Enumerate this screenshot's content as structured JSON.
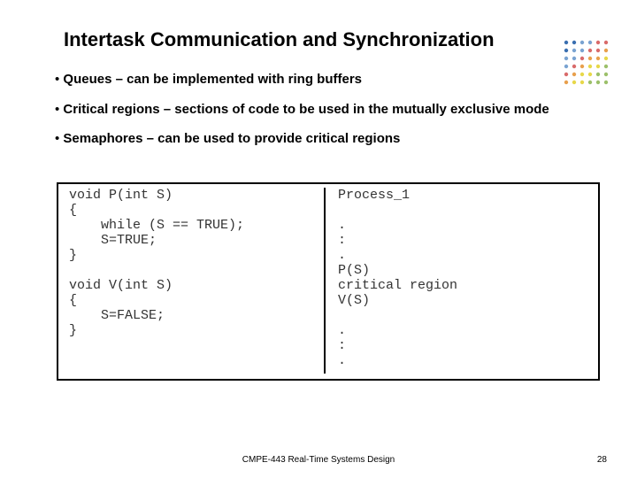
{
  "title": "Intertask Communication and Synchronization",
  "bullets": [
    {
      "prefix": "• ",
      "lead": "Queues",
      "rest": " – can be implemented with ring buffers"
    },
    {
      "prefix": "• ",
      "lead": "Critical regions",
      "rest": " – sections of code to be used in the mutually exclusive mode"
    },
    {
      "prefix": "• ",
      "lead": "Semaphores",
      "rest": " – can be used to provide critical regions"
    }
  ],
  "code_left": "void P(int S)\n{\n    while (S == TRUE);\n    S=TRUE;\n}\n\nvoid V(int S)\n{\n    S=FALSE;\n}",
  "code_right": "Process_1\n\n.\n:\n.\nP(S)\ncritical region\nV(S)\n\n.\n:\n.",
  "footer_center": "CMPE-443 Real-Time Systems Design",
  "footer_right": "28",
  "logo_colors": {
    "c1": "#3a6fb0",
    "c2": "#7aa3d1",
    "c3": "#d96b6b",
    "c4": "#e8a04d",
    "c5": "#e7d84a",
    "c6": "#9cc06a"
  }
}
